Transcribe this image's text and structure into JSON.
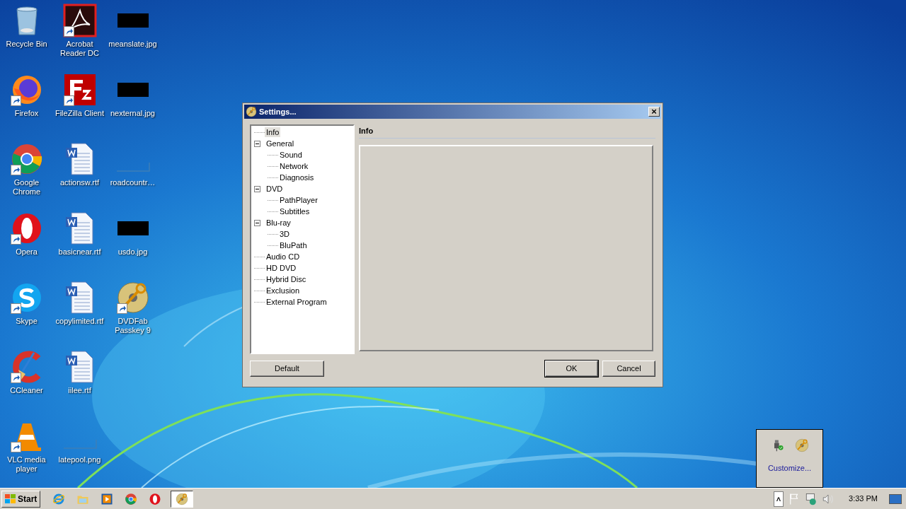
{
  "desktop_icons": [
    {
      "label": "Recycle Bin",
      "kind": "bin",
      "shortcut": false
    },
    {
      "label": "Acrobat Reader DC",
      "kind": "pdf",
      "shortcut": true
    },
    {
      "label": "meanslate.jpg",
      "kind": "dark_image",
      "shortcut": false
    },
    {
      "label": "Firefox",
      "kind": "firefox",
      "shortcut": true
    },
    {
      "label": "FileZilla Client",
      "kind": "filezilla",
      "shortcut": true
    },
    {
      "label": "nexternal.jpg",
      "kind": "dark_image",
      "shortcut": false
    },
    {
      "label": "Google Chrome",
      "kind": "chrome",
      "shortcut": true
    },
    {
      "label": "actionsw.rtf",
      "kind": "document",
      "shortcut": false
    },
    {
      "label": "roadcountr…",
      "kind": "blank_image",
      "shortcut": false
    },
    {
      "label": "Opera",
      "kind": "opera",
      "shortcut": true
    },
    {
      "label": "basicnear.rtf",
      "kind": "document",
      "shortcut": false
    },
    {
      "label": "usdo.jpg",
      "kind": "dark_image",
      "shortcut": false
    },
    {
      "label": "Skype",
      "kind": "skype",
      "shortcut": true
    },
    {
      "label": "copylimited.rtf",
      "kind": "document",
      "shortcut": false
    },
    {
      "label": "DVDFab Passkey 9",
      "kind": "disc",
      "shortcut": true
    },
    {
      "label": "CCleaner",
      "kind": "ccleaner",
      "shortcut": true
    },
    {
      "label": "iilee.rtf",
      "kind": "document",
      "shortcut": false
    },
    {
      "kind": "empty"
    },
    {
      "label": "VLC media player",
      "kind": "vlc",
      "shortcut": true
    },
    {
      "label": "latepool.png",
      "kind": "blank_image",
      "shortcut": false
    }
  ],
  "dialog": {
    "title": "Settings...",
    "close": "×",
    "tree": [
      {
        "label": "Info",
        "selected": true
      },
      {
        "label": "General",
        "selected": false,
        "expanded": true,
        "children": [
          {
            "label": "Sound",
            "selected": false
          },
          {
            "label": "Network",
            "selected": false
          },
          {
            "label": "Diagnosis",
            "selected": false
          }
        ]
      },
      {
        "label": "DVD",
        "selected": false,
        "expanded": true,
        "children": [
          {
            "label": "PathPlayer",
            "selected": false
          },
          {
            "label": "Subtitles",
            "selected": false
          }
        ]
      },
      {
        "label": "Blu-ray",
        "selected": false,
        "expanded": true,
        "children": [
          {
            "label": "3D",
            "selected": false
          },
          {
            "label": "BluPath",
            "selected": false
          }
        ]
      },
      {
        "label": "Audio CD",
        "selected": false
      },
      {
        "label": "HD DVD",
        "selected": false
      },
      {
        "label": "Hybrid Disc",
        "selected": false
      },
      {
        "label": "Exclusion",
        "selected": false
      },
      {
        "label": "External Program",
        "selected": false
      }
    ],
    "panel_title": "Info",
    "buttons": {
      "left": "Default",
      "ok": "OK",
      "cancel": "Cancel"
    }
  },
  "tray_popup": {
    "link": "Customize...",
    "icons": [
      {
        "kind": "usb"
      },
      {
        "kind": "disc"
      }
    ]
  },
  "taskbar": {
    "start": "Start",
    "apps": [
      {
        "kind": "ie",
        "active": false
      },
      {
        "kind": "folder",
        "active": false
      },
      {
        "kind": "media",
        "active": false
      },
      {
        "kind": "chrome",
        "active": false
      },
      {
        "kind": "opera",
        "active": false
      },
      {
        "kind": "disc",
        "active": true
      }
    ],
    "tray": {
      "expand": "˄",
      "icons": [
        {
          "kind": "flag"
        },
        {
          "kind": "network"
        },
        {
          "kind": "speaker"
        }
      ],
      "time": "3:33 PM"
    }
  }
}
